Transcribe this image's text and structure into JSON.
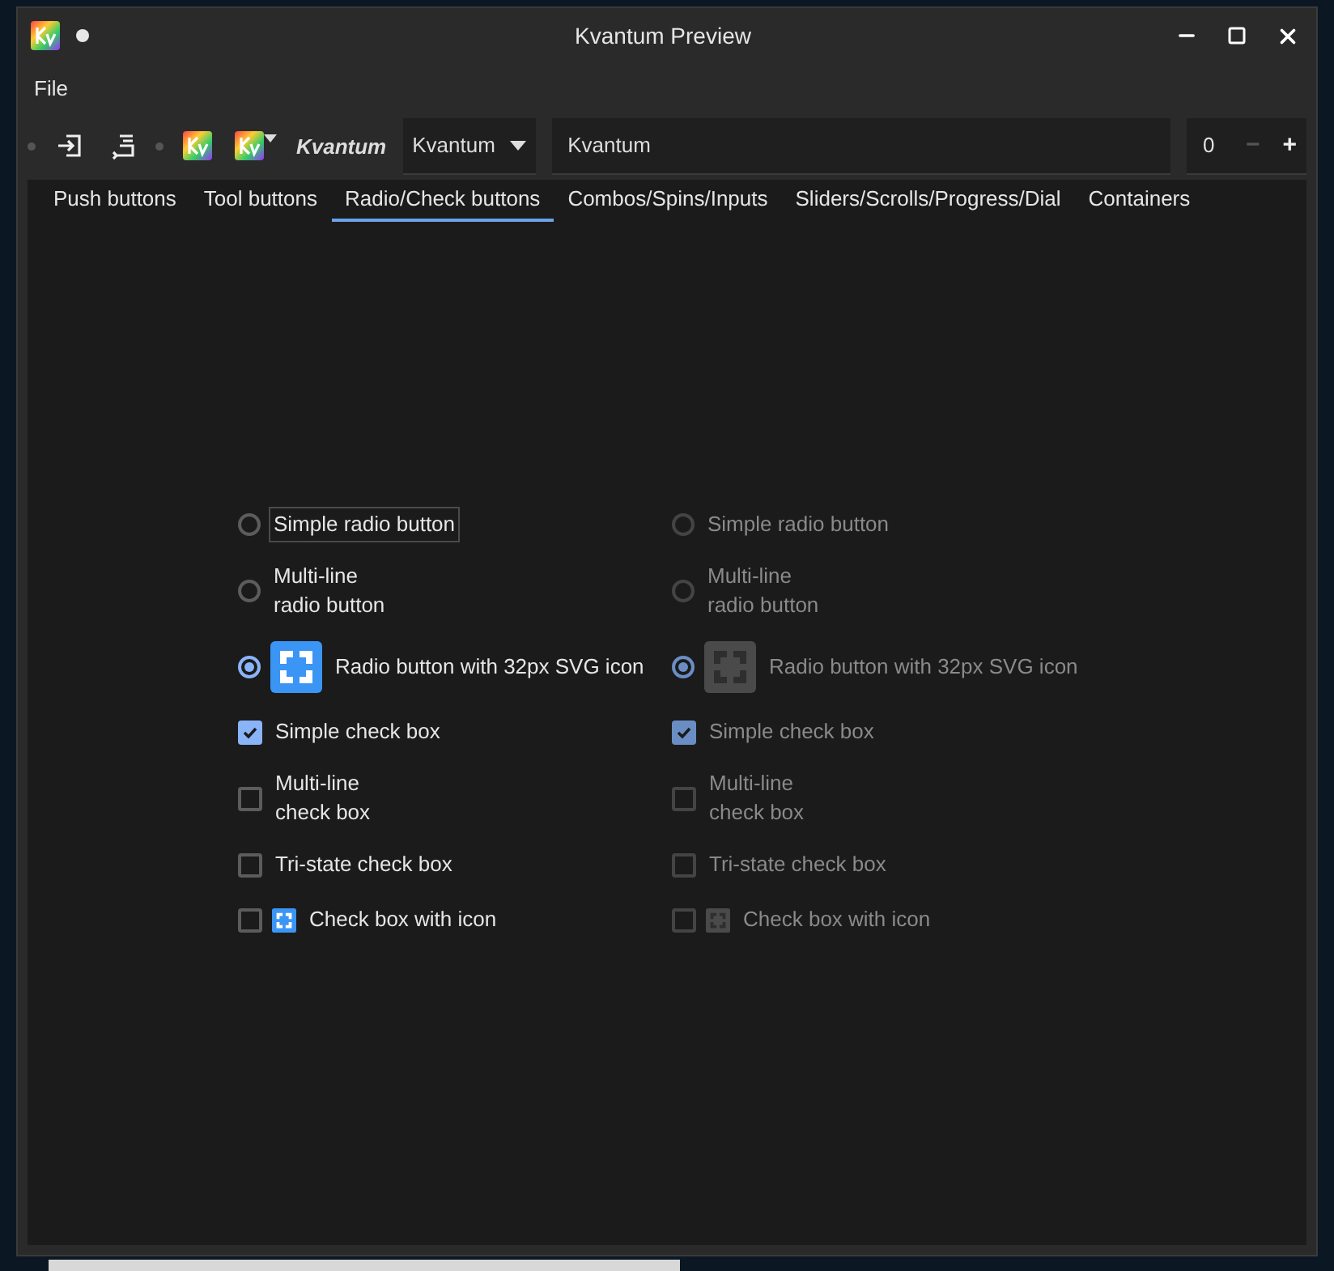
{
  "window": {
    "title": "Kvantum Preview"
  },
  "menu": [
    "File"
  ],
  "toolbar": {
    "style_label": "Kvantum",
    "combo": {
      "value": "Kvantum"
    },
    "field": {
      "value": "Kvantum"
    },
    "spin": {
      "value": "0",
      "minus": "−",
      "plus": "+",
      "minus_disabled": true
    }
  },
  "tabs": [
    {
      "label": "Push buttons",
      "selected": false
    },
    {
      "label": "Tool buttons",
      "selected": false
    },
    {
      "label": "Radio/Check buttons",
      "selected": true
    },
    {
      "label": "Combos/Spins/Inputs",
      "selected": false
    },
    {
      "label": "Sliders/Scrolls/Progress/Dial",
      "selected": false
    },
    {
      "label": "Containers",
      "selected": false
    }
  ],
  "columns": [
    {
      "disabled": false,
      "items": [
        {
          "kind": "radio",
          "label": "Simple radio button",
          "selected": false,
          "focused": true
        },
        {
          "kind": "radio",
          "label": "Multi-line\nradio button",
          "selected": false,
          "focused": false
        },
        {
          "kind": "iconradio",
          "label": "Radio button with 32px SVG icon",
          "selected": true,
          "focused": false
        },
        {
          "kind": "check",
          "label": "Simple check box",
          "checked": true,
          "focused": false
        },
        {
          "kind": "check",
          "label": "Multi-line\ncheck box",
          "checked": false,
          "focused": false
        },
        {
          "kind": "check",
          "label": "Tri-state check box",
          "checked": false,
          "focused": false
        },
        {
          "kind": "iconcheck",
          "label": "Check box with icon",
          "checked": false,
          "focused": false
        }
      ]
    },
    {
      "disabled": true,
      "items": [
        {
          "kind": "radio",
          "label": "Simple radio button",
          "selected": false,
          "focused": false
        },
        {
          "kind": "radio",
          "label": "Multi-line\nradio button",
          "selected": false,
          "focused": false
        },
        {
          "kind": "iconradio",
          "label": "Radio button with 32px SVG icon",
          "selected": true,
          "focused": false
        },
        {
          "kind": "check",
          "label": "Simple check box",
          "checked": true,
          "focused": false
        },
        {
          "kind": "check",
          "label": "Multi-line\ncheck box",
          "checked": false,
          "focused": false
        },
        {
          "kind": "check",
          "label": "Tri-state check box",
          "checked": false,
          "focused": false
        },
        {
          "kind": "iconcheck",
          "label": "Check box with icon",
          "checked": false,
          "focused": false
        }
      ]
    }
  ]
}
